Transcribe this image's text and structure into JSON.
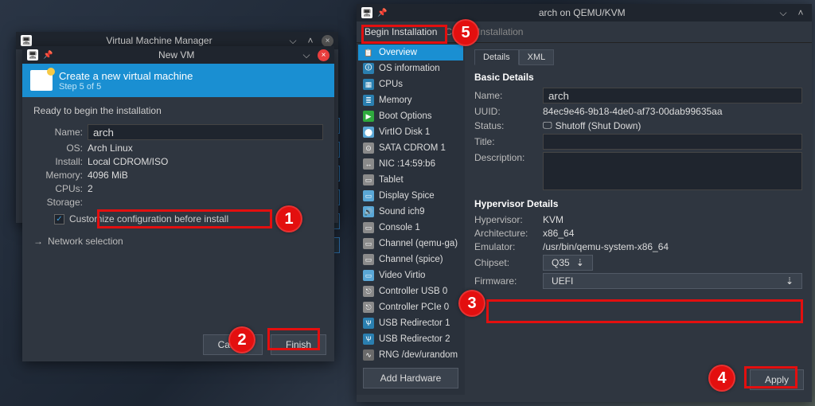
{
  "vmm": {
    "title": "Virtual Machine Manager"
  },
  "newvm": {
    "title": "New VM",
    "banner_title": "Create a new virtual machine",
    "banner_step": "Step 5 of 5",
    "ready": "Ready to begin the installation",
    "name_label": "Name:",
    "name_value": "arch",
    "os_label": "OS:",
    "os_value": "Arch Linux",
    "install_label": "Install:",
    "install_value": "Local CDROM/ISO",
    "memory_label": "Memory:",
    "memory_value": "4096 MiB",
    "cpus_label": "CPUs:",
    "cpus_value": "2",
    "storage_label": "Storage:",
    "customize_label": "Customize configuration before install",
    "network_label": "Network selection",
    "cancel": "Cancel",
    "finish": "Finish"
  },
  "details": {
    "title": "arch on QEMU/KVM",
    "begin": "Begin Installation",
    "cancel_install": "Cancel Installation",
    "sidebar": [
      {
        "label": "Overview",
        "icon": "📋",
        "c": "#1a8fd2",
        "sel": true
      },
      {
        "label": "OS information",
        "icon": "🛈",
        "c": "#2a7fb0"
      },
      {
        "label": "CPUs",
        "icon": "▦",
        "c": "#2a7fb0"
      },
      {
        "label": "Memory",
        "icon": "≣",
        "c": "#2a7fb0"
      },
      {
        "label": "Boot Options",
        "icon": "▶",
        "c": "#2faa3e"
      },
      {
        "label": "VirtIO Disk 1",
        "icon": "⬤",
        "c": "#5aa7d6"
      },
      {
        "label": "SATA CDROM 1",
        "icon": "⊙",
        "c": "#8a8a8a"
      },
      {
        "label": "NIC :14:59:b6",
        "icon": "↔",
        "c": "#8a8a8a"
      },
      {
        "label": "Tablet",
        "icon": "▭",
        "c": "#8a8a8a"
      },
      {
        "label": "Display Spice",
        "icon": "▭",
        "c": "#5aa7d6"
      },
      {
        "label": "Sound ich9",
        "icon": "🔊",
        "c": "#5aa7d6"
      },
      {
        "label": "Console 1",
        "icon": "▭",
        "c": "#8a8a8a"
      },
      {
        "label": "Channel (qemu-ga)",
        "icon": "▭",
        "c": "#8a8a8a"
      },
      {
        "label": "Channel (spice)",
        "icon": "▭",
        "c": "#8a8a8a"
      },
      {
        "label": "Video Virtio",
        "icon": "▭",
        "c": "#5aa7d6"
      },
      {
        "label": "Controller USB 0",
        "icon": "⎋",
        "c": "#8a8a8a"
      },
      {
        "label": "Controller PCIe 0",
        "icon": "⎋",
        "c": "#8a8a8a"
      },
      {
        "label": "USB Redirector 1",
        "icon": "Ѱ",
        "c": "#2a7fb0"
      },
      {
        "label": "USB Redirector 2",
        "icon": "Ѱ",
        "c": "#2a7fb0"
      },
      {
        "label": "RNG /dev/urandom",
        "icon": "∿",
        "c": "#6a6a6a"
      }
    ],
    "add_hardware": "Add Hardware",
    "tabs": {
      "details": "Details",
      "xml": "XML"
    },
    "basic": {
      "heading": "Basic Details",
      "name_label": "Name:",
      "name_value": "arch",
      "uuid_label": "UUID:",
      "uuid_value": "84ec9e46-9b18-4de0-af73-00dab99635aa",
      "status_label": "Status:",
      "status_value": "Shutoff (Shut Down)",
      "title_label": "Title:",
      "desc_label": "Description:"
    },
    "hyp": {
      "heading": "Hypervisor Details",
      "hypervisor_label": "Hypervisor:",
      "hypervisor_value": "KVM",
      "arch_label": "Architecture:",
      "arch_value": "x86_64",
      "emu_label": "Emulator:",
      "emu_value": "/usr/bin/qemu-system-x86_64",
      "chipset_label": "Chipset:",
      "chipset_value": "Q35",
      "firmware_label": "Firmware:",
      "firmware_value": "UEFI"
    },
    "apply": "Apply"
  },
  "markers": {
    "m1": "1",
    "m2": "2",
    "m3": "3",
    "m4": "4",
    "m5": "5"
  }
}
